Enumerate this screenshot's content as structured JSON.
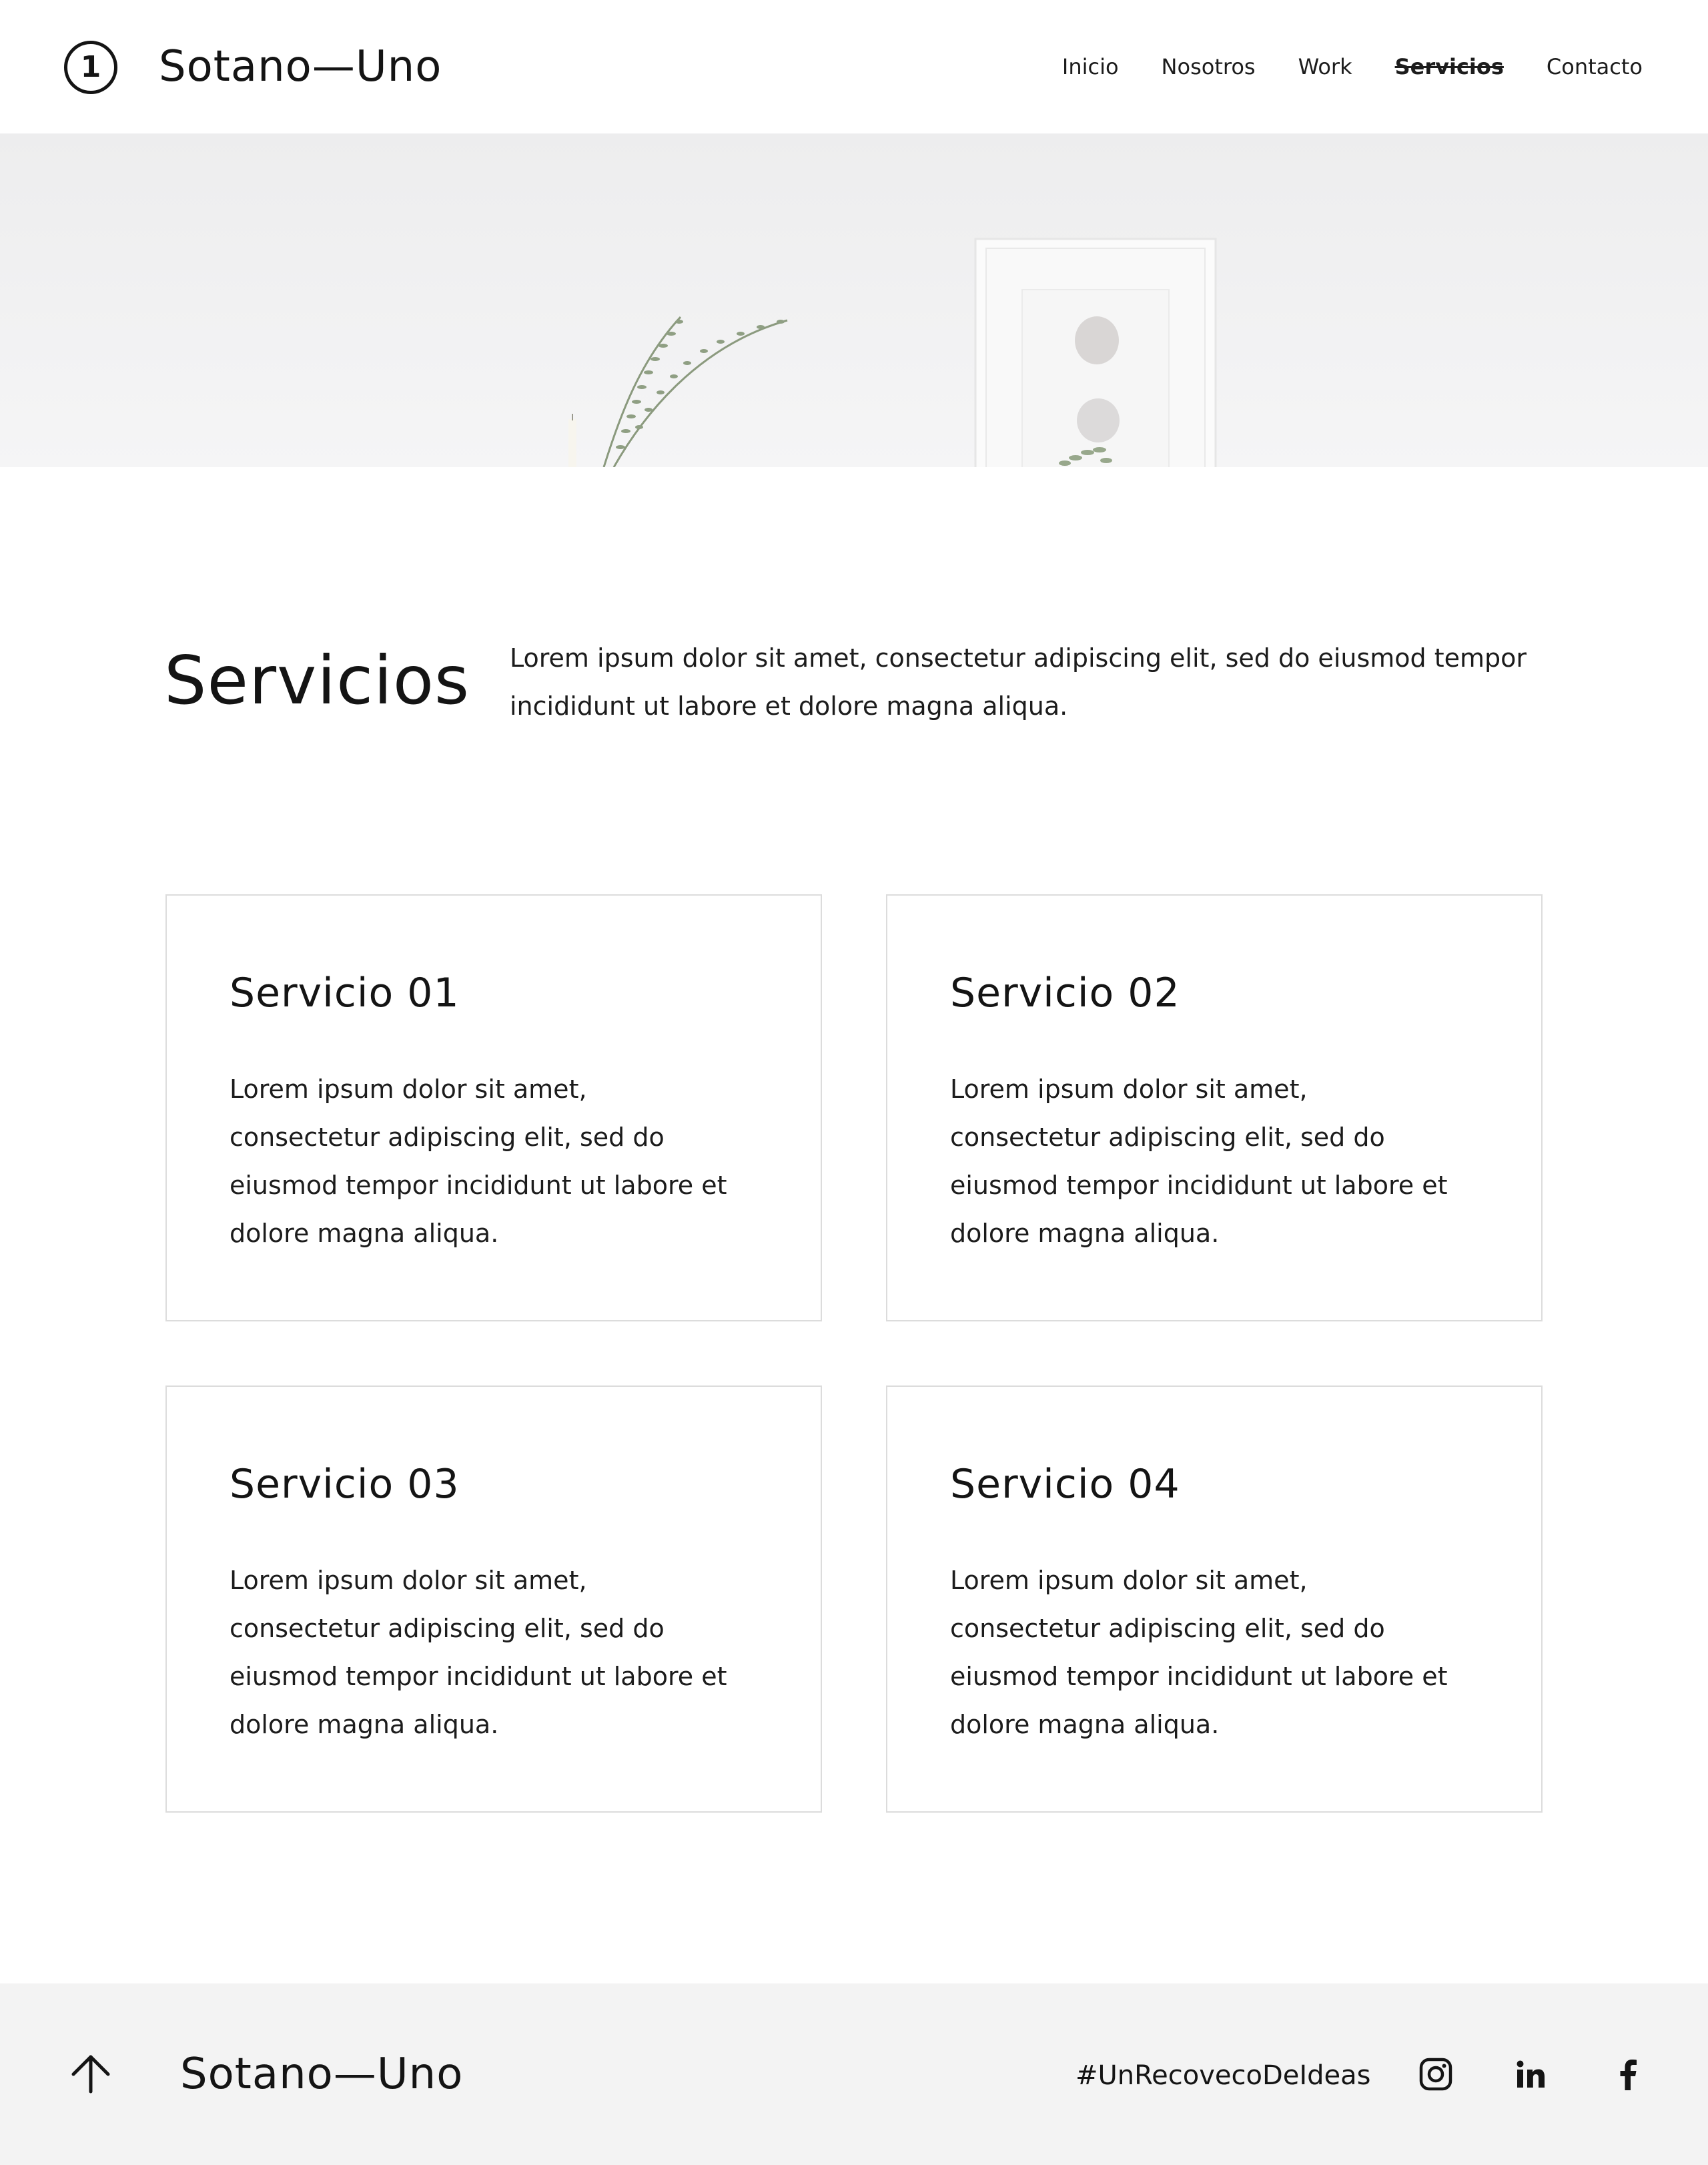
{
  "header": {
    "logo_number": "1",
    "brand": "Sotano—Uno",
    "nav": [
      {
        "label": "Inicio",
        "active": false
      },
      {
        "label": "Nosotros",
        "active": false
      },
      {
        "label": "Work",
        "active": false
      },
      {
        "label": "Servicios",
        "active": true
      },
      {
        "label": "Contacto",
        "active": false
      }
    ]
  },
  "intro": {
    "title": "Servicios",
    "text": "Lorem ipsum dolor sit amet, consectetur adipiscing elit, sed do eiusmod tempor incididunt ut labore et dolore magna aliqua."
  },
  "services": [
    {
      "title": "Servicio 01",
      "text": "Lorem ipsum dolor sit amet, consectetur adipiscing elit, sed do eiusmod tempor incididunt ut labore et dolore magna aliqua."
    },
    {
      "title": "Servicio 02",
      "text": "Lorem ipsum dolor sit amet, consectetur adipiscing elit, sed do eiusmod tempor incididunt ut labore et dolore magna aliqua."
    },
    {
      "title": "Servicio 03",
      "text": "Lorem ipsum dolor sit amet, consectetur adipiscing elit, sed do eiusmod tempor incididunt ut labore et dolore magna aliqua."
    },
    {
      "title": "Servicio 04",
      "text": "Lorem ipsum dolor sit amet, consectetur adipiscing elit, sed do eiusmod tempor incididunt ut labore et dolore magna aliqua."
    }
  ],
  "footer": {
    "brand": "Sotano—Uno",
    "hashtag": "#UnRecovecoDeIdeas",
    "icons": [
      "arrow-up-icon",
      "instagram-icon",
      "linkedin-icon",
      "facebook-icon"
    ]
  },
  "colors": {
    "text": "#141414",
    "card_border": "#dcdcdc",
    "footer_bg": "#f3f3f3",
    "hero_bg": "#eeeeef"
  }
}
